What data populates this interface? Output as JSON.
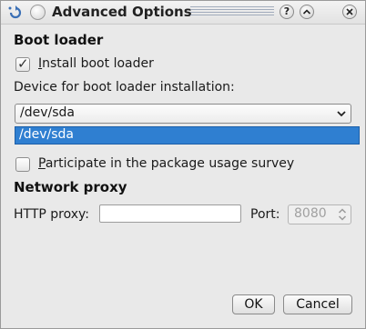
{
  "window": {
    "title": "Advanced Options",
    "help_label": "?",
    "shade_label": "^",
    "close_label": "×"
  },
  "boot_loader": {
    "section_title": "Boot loader",
    "install_checked": true,
    "install_label_first": "I",
    "install_label_rest": "nstall boot loader",
    "device_label": "Device for boot loader installation:",
    "device_selected": "/dev/sda",
    "device_options": [
      "/dev/sda"
    ]
  },
  "survey": {
    "checked": false,
    "label_first": "P",
    "label_rest": "articipate in the package usage survey"
  },
  "network_proxy": {
    "section_title": "Network proxy",
    "http_label": "HTTP proxy:",
    "http_value": "",
    "port_label": "Port:",
    "port_value": "8080"
  },
  "buttons": {
    "ok_label": "OK",
    "cancel_label": "Cancel"
  },
  "icons": {
    "app": "app-menu-icon",
    "sticky": "sticky-circle-icon",
    "check": "checkmark-icon",
    "combo_arrow": "chevron-down-icon",
    "spin_arrows": "spin-updown-icon"
  },
  "colors": {
    "selection": "#2f7fd1",
    "background": "#e9e9e9"
  }
}
